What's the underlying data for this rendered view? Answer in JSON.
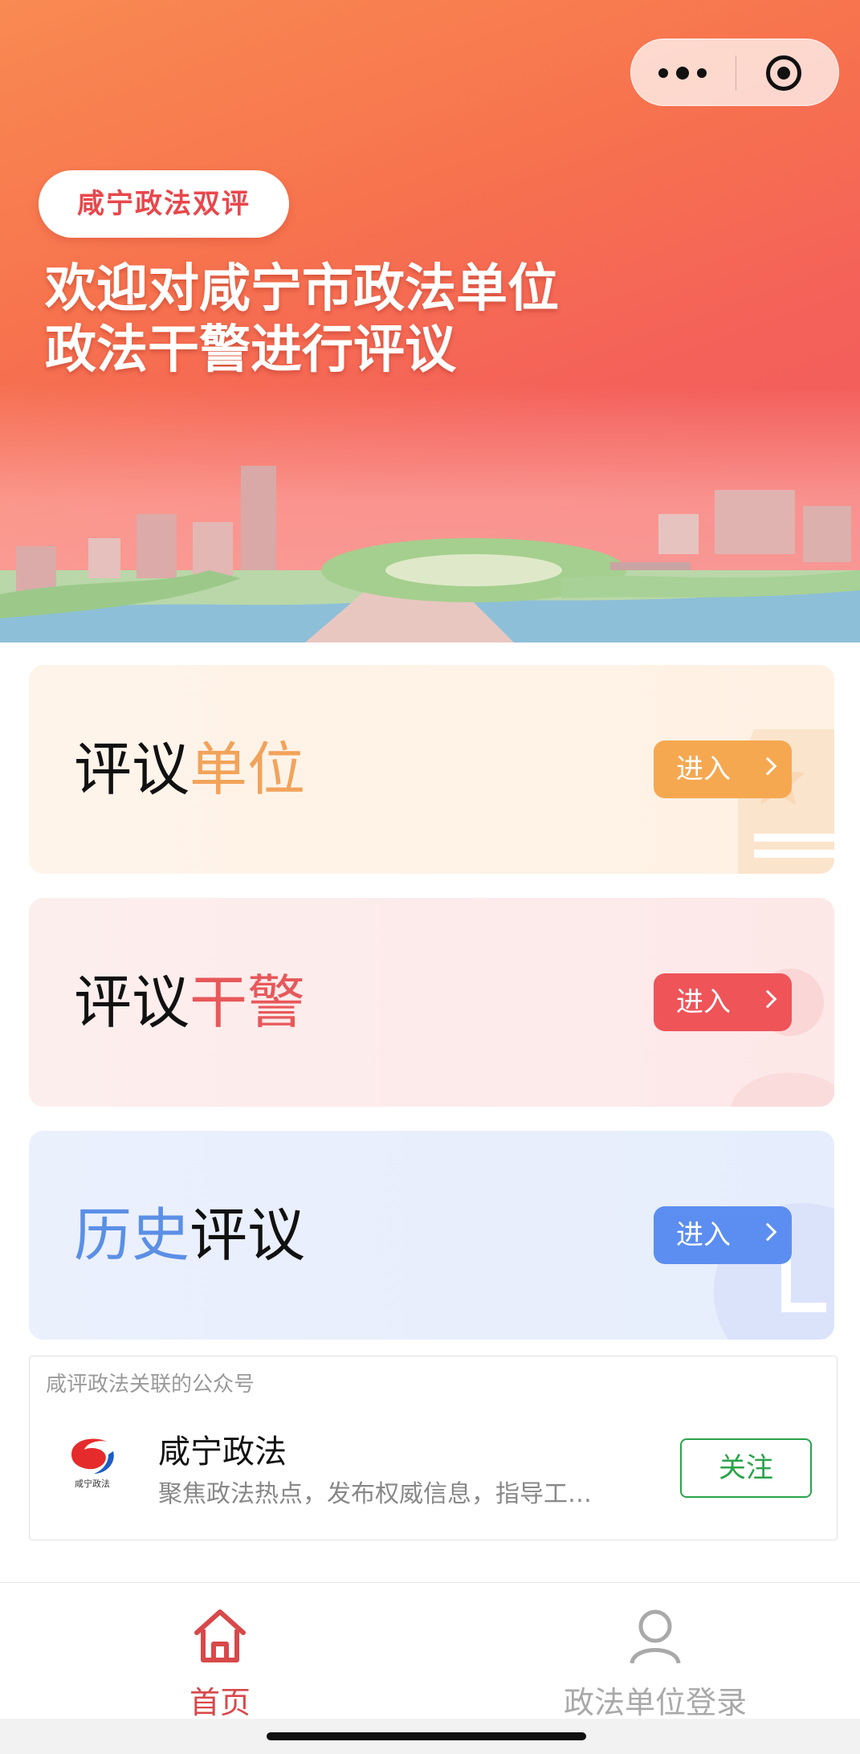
{
  "capsule": {
    "more_icon": "more-dots-icon",
    "close_icon": "miniprogram-close-icon"
  },
  "hero": {
    "tag": "咸宁政法双评",
    "title_line1": "欢迎对咸宁市政法单位",
    "title_line2": "政法干警进行评议"
  },
  "cards": [
    {
      "title_a": "评议",
      "title_b": "单位",
      "button": "进入",
      "accent": "#f5a850"
    },
    {
      "title_a": "评议",
      "title_b": "干警",
      "button": "进入",
      "accent": "#ef5459"
    },
    {
      "title_a": "历史",
      "title_b": "评议",
      "button": "进入",
      "accent": "#5b8ef0"
    }
  ],
  "official_account": {
    "caption": "咸评政法关联的公众号",
    "name": "咸宁政法",
    "description": "聚焦政法热点，发布权威信息，指导工…",
    "follow_label": "关注",
    "logo_text": "咸宁政法"
  },
  "tabbar": {
    "items": [
      {
        "label": "首页",
        "icon": "home-icon",
        "active": true
      },
      {
        "label": "政法单位登录",
        "icon": "user-icon",
        "active": false
      }
    ],
    "active_color": "#d8484a"
  }
}
